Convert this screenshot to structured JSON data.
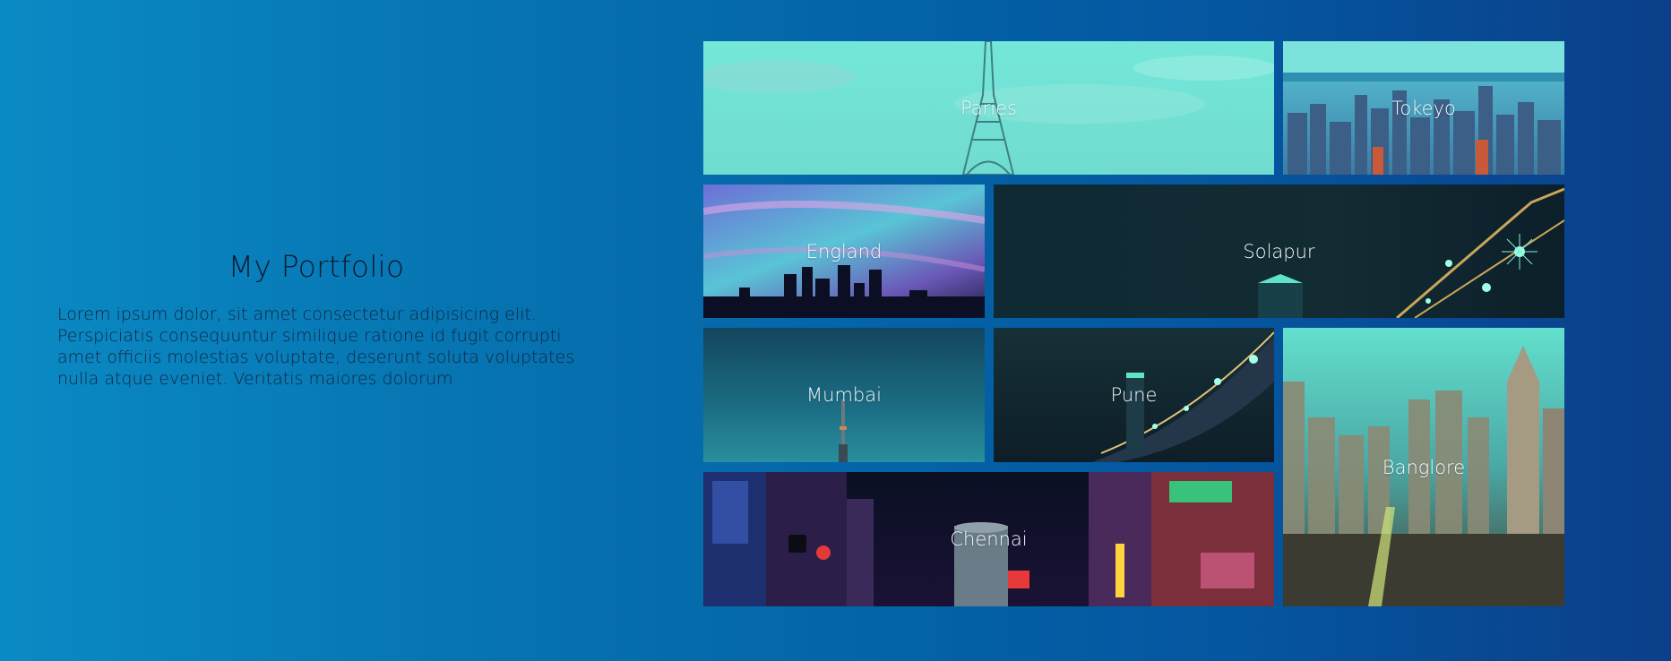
{
  "intro": {
    "title": "My Portfolio",
    "body": "Lorem ipsum dolor, sit amet consectetur adipisicing elit. Perspiciatis consequuntur similique ratione id fugit corrupti amet officiis molestias voluptate, deserunt soluta voluptates nulla atque eveniet. Veritatis maiores dolorum"
  },
  "gallery": {
    "tiles": [
      {
        "label": "Paries"
      },
      {
        "label": "Tokeyo"
      },
      {
        "label": "England"
      },
      {
        "label": "Solapur"
      },
      {
        "label": "Mumbai"
      },
      {
        "label": "Pune"
      },
      {
        "label": "Banglore"
      },
      {
        "label": "Chennai"
      }
    ]
  },
  "colors": {
    "background_start": "#0a8ac4",
    "background_end": "#0b3f8a",
    "tile_tint": "#74e7d9",
    "label_text": "#f2fbff",
    "heading_text": "#0c1a30"
  }
}
